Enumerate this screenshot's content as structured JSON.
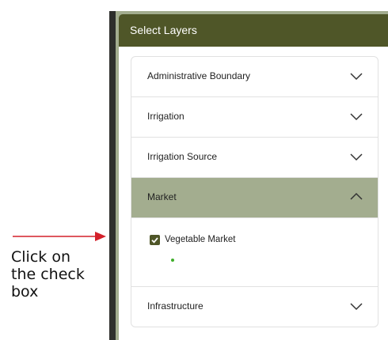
{
  "annotation": {
    "instruction": "Click on\nthe check\nbox",
    "arrow_color": "#d4202a"
  },
  "panel": {
    "title": "Select Layers",
    "header_color": "#4f5628",
    "accent_color": "#a3ad8f"
  },
  "layers": [
    {
      "label": "Administrative Boundary",
      "expanded": false
    },
    {
      "label": "Irrigation",
      "expanded": false
    },
    {
      "label": "Irrigation Source",
      "expanded": false
    },
    {
      "label": "Market",
      "expanded": true
    },
    {
      "label": "Infrastructure",
      "expanded": false
    }
  ],
  "market": {
    "items": [
      {
        "label": "Vegetable Market",
        "checked": true,
        "legend_color": "#3fae2a"
      }
    ]
  },
  "icons": {
    "collapsed": "chevron-down-icon",
    "expanded": "chevron-up-icon",
    "checkbox": "checkmark-icon"
  }
}
